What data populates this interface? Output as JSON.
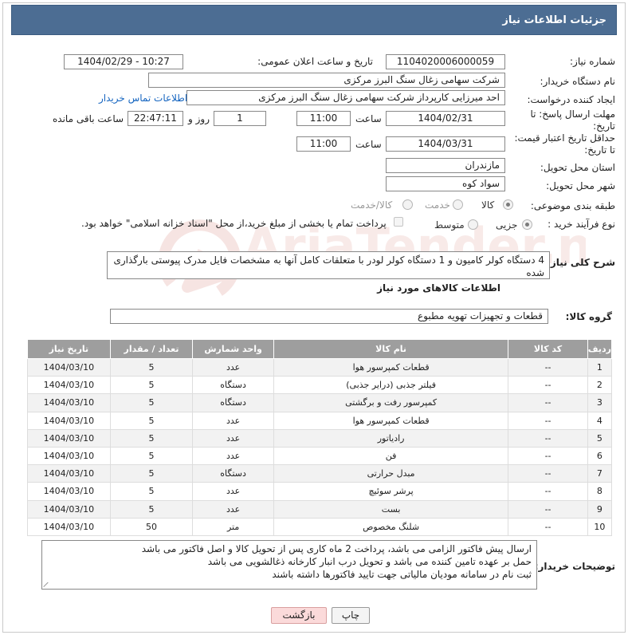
{
  "header": {
    "title": "جزئیات اطلاعات نیاز"
  },
  "form": {
    "need_number": {
      "label": "شماره نیاز:",
      "value": "1104020006000059"
    },
    "announce_datetime": {
      "label": "تاریخ و ساعت اعلان عمومی:",
      "value": "1404/02/29 - 10:27"
    },
    "buyer_org": {
      "label": "نام دستگاه خریدار:",
      "value": "شرکت سهامی زغال سنگ البرز مرکزی"
    },
    "requester": {
      "label": "ایجاد کننده درخواست:",
      "value": "احد میرزایی کارپرداز شرکت سهامی زغال سنگ البرز مرکزی",
      "contact_link": "اطلاعات تماس خریدار"
    },
    "reply_deadline": {
      "label": "مهلت ارسال پاسخ: تا تاریخ:",
      "date": "1404/02/31",
      "time_label": "ساعت",
      "time": "11:00",
      "days": "1",
      "days_label": "روز و",
      "remaining": "22:47:11",
      "remaining_label": "ساعت باقی مانده"
    },
    "price_validity": {
      "label": "حداقل تاریخ اعتبار قیمت: تا تاریخ:",
      "date": "1404/03/31",
      "time_label": "ساعت",
      "time": "11:00"
    },
    "delivery_province": {
      "label": "استان محل تحویل:",
      "value": "مازندران"
    },
    "delivery_city": {
      "label": "شهر محل تحویل:",
      "value": "سواد کوه"
    },
    "category": {
      "label": "طبقه بندی موضوعی:",
      "options": [
        "کالا",
        "خدمت",
        "کالا/خدمت"
      ],
      "selected": "کالا"
    },
    "process_type": {
      "label": "نوع فرآیند خرید :",
      "options": [
        "جزیی",
        "متوسط"
      ],
      "selected": "جزیی",
      "payment_note": "پرداخت تمام یا بخشی از مبلغ خرید،از محل \"اسناد خزانه اسلامی\" خواهد بود."
    },
    "general_desc": {
      "label": "شرح کلی نیاز:",
      "value": "4 دستگاه کولر کامیون و 1 دستگاه کولر لودر با متعلقات کامل آنها به مشخصات فایل مدرک پیوستی بارگذاری شده"
    }
  },
  "goods": {
    "section_title": "اطلاعات کالاهای مورد نیاز",
    "group_label": "گروه کالا:",
    "group_value": "قطعات و تجهیزات تهویه مطبوع",
    "columns": [
      "ردیف",
      "کد کالا",
      "نام کالا",
      "واحد شمارش",
      "تعداد / مقدار",
      "تاریخ نیاز"
    ],
    "rows": [
      [
        "1",
        "--",
        "قطعات کمپرسور هوا",
        "عدد",
        "5",
        "1404/03/10"
      ],
      [
        "2",
        "--",
        "فیلتر جذبی (درایر جذبی)",
        "دستگاه",
        "5",
        "1404/03/10"
      ],
      [
        "3",
        "--",
        "کمپرسور رفت و برگشتی",
        "دستگاه",
        "5",
        "1404/03/10"
      ],
      [
        "4",
        "--",
        "قطعات کمپرسور هوا",
        "عدد",
        "5",
        "1404/03/10"
      ],
      [
        "5",
        "--",
        "رادیاتور",
        "عدد",
        "5",
        "1404/03/10"
      ],
      [
        "6",
        "--",
        "فن",
        "عدد",
        "5",
        "1404/03/10"
      ],
      [
        "7",
        "--",
        "مبدل حرارتی",
        "دستگاه",
        "5",
        "1404/03/10"
      ],
      [
        "8",
        "--",
        "پرشر سوئیچ",
        "عدد",
        "5",
        "1404/03/10"
      ],
      [
        "9",
        "--",
        "بست",
        "عدد",
        "5",
        "1404/03/10"
      ],
      [
        "10",
        "--",
        "شلنگ مخصوص",
        "متر",
        "50",
        "1404/03/10"
      ]
    ]
  },
  "buyer_notes": {
    "label": "توضیحات خریدار:",
    "lines": [
      "ارسال پیش فاکتور الزامی می باشد، پرداخت 2 ماه کاری پس از تحویل کالا و اصل فاکتور می باشد",
      "حمل بر عهده تامین کننده می باشد و تحویل درب انبار کارخانه ذغالشویی می باشد",
      "ثبت نام در سامانه مودیان مالیاتی جهت تایید فاکتورها داشته باشند"
    ]
  },
  "buttons": {
    "print": "چاپ",
    "back": "بازگشت"
  },
  "watermark": {
    "text": "AriaTender.neT"
  },
  "colors": {
    "header_bg": "#4c6d93",
    "table_header_bg": "#9e9e9e",
    "back_button_bg": "#fbdada",
    "link": "#1565c0"
  }
}
